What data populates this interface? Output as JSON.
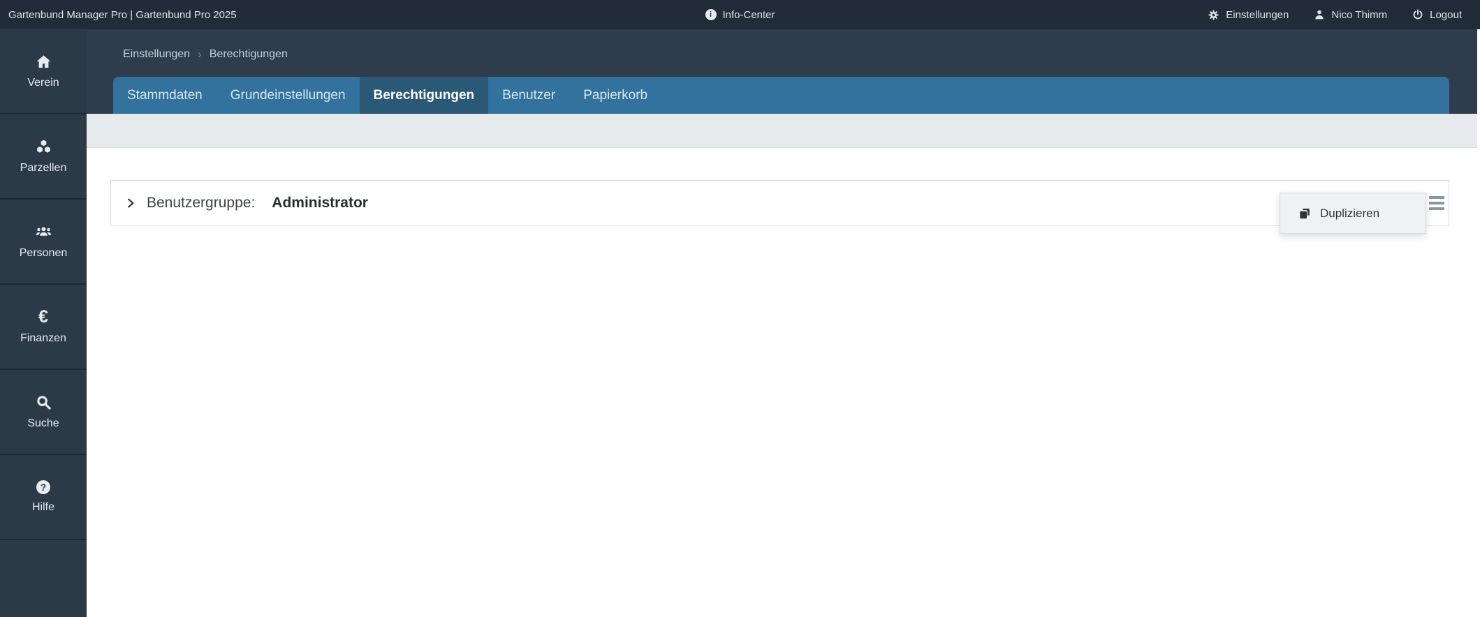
{
  "topbar": {
    "app_title": "Gartenbund Manager Pro | Gartenbund Pro 2025",
    "info_center_label": "Info-Center",
    "settings_label": "Einstellungen",
    "user_name": "Nico Thimm",
    "logout_label": "Logout"
  },
  "sidebar": {
    "items": [
      {
        "label": "Verein",
        "icon": "home-icon"
      },
      {
        "label": "Parzellen",
        "icon": "cubes-icon"
      },
      {
        "label": "Personen",
        "icon": "users-icon"
      },
      {
        "label": "Finanzen",
        "icon": "euro-icon"
      },
      {
        "label": "Suche",
        "icon": "search-icon"
      },
      {
        "label": "Hilfe",
        "icon": "question-circle-icon"
      }
    ]
  },
  "breadcrumb": {
    "items": [
      "Einstellungen",
      "Berechtigungen"
    ],
    "separator": "›"
  },
  "tabs": [
    {
      "label": "Stammdaten",
      "active": false
    },
    {
      "label": "Grundeinstellungen",
      "active": false
    },
    {
      "label": "Berechtigungen",
      "active": true
    },
    {
      "label": "Benutzer",
      "active": false
    },
    {
      "label": "Papierkorb",
      "active": false
    }
  ],
  "panel": {
    "label": "Benutzergruppe:",
    "value": "Administrator"
  },
  "context_menu": {
    "items": [
      {
        "label": "Duplizieren",
        "icon": "copy-icon"
      }
    ]
  },
  "icon_glyphs": {
    "info": "i",
    "question": "?",
    "euro": "€"
  },
  "colors": {
    "topbar_bg": "#222c39",
    "sidebar_bg": "#2c3a48",
    "header_bg": "#2e3c4b",
    "tabbar_bg": "#32729d",
    "tab_active_bg": "#2a5877",
    "subband_bg": "#e6eaed",
    "menu_bg": "#f0f1f3"
  }
}
